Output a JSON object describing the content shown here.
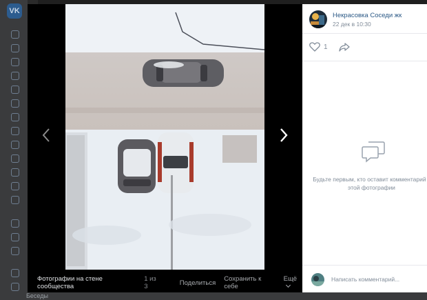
{
  "background": {
    "logo_text": "VK",
    "bottom_text": "Беседы"
  },
  "post": {
    "author": "Некрасовка Соседи жк",
    "date": "22 дек в 10:30",
    "likes": "1"
  },
  "viewer": {
    "source_label": "Фотографии на стене сообщества",
    "counter": "1 из 3",
    "actions": {
      "share": "Поделиться",
      "save": "Сохранить к себе",
      "more": "Ещё"
    }
  },
  "comments": {
    "empty_text": "Будьте первым, кто оставит комментарий к этой фотографии",
    "input_placeholder": "Написать комментарий..."
  },
  "colors": {
    "link": "#2a5885",
    "secondary_text": "#818c99",
    "viewer_bg": "#000000",
    "panel_bg": "#ffffff"
  },
  "icons": [
    "vk-logo-icon",
    "chevron-left-icon",
    "chevron-right-icon",
    "heart-icon",
    "share-arrow-icon",
    "comment-bubble-icon",
    "chevron-down-icon"
  ]
}
